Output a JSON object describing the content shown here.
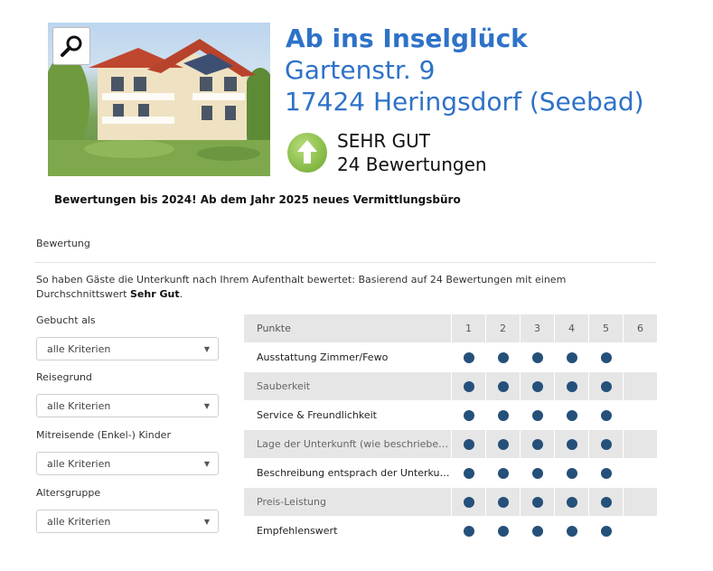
{
  "listing": {
    "title": "Ab ins Inselglück",
    "address_line1": "Gartenstr. 9",
    "address_line2": "17424 Heringsdorf (Seebad)"
  },
  "score": {
    "label": "SEHR GUT",
    "count_text": "24 Bewertungen",
    "icon": "arrow-up-icon",
    "icon_color": "#8cc04b"
  },
  "notice": "Bewertungen bis 2024! Ab dem Jahr 2025 neues Vermittlungsbüro",
  "section_label": "Bewertung",
  "description": {
    "text": "So haben Gäste die Unterkunft nach Ihrem Aufenthalt bewertet:  Basierend auf 24 Bewertungen mit einem Durchschnittswert",
    "bold": "Sehr Gut",
    "end": "."
  },
  "filters": [
    {
      "label": "Gebucht als",
      "value": "alle Kriterien"
    },
    {
      "label": "Reisegrund",
      "value": "alle Kriterien"
    },
    {
      "label": "Mitreisende (Enkel-) Kinder",
      "value": "alle Kriterien"
    },
    {
      "label": "Altersgruppe",
      "value": "alle Kriterien"
    }
  ],
  "ratings": {
    "header": "Punkte",
    "scale": [
      "1",
      "2",
      "3",
      "4",
      "5",
      "6"
    ],
    "rows": [
      {
        "label": "Ausstattung Zimmer/Fewo",
        "points": 5
      },
      {
        "label": "Sauberkeit",
        "points": 5
      },
      {
        "label": "Service & Freundlichkeit",
        "points": 5
      },
      {
        "label": "Lage der Unterkunft (wie beschriebe…",
        "points": 5
      },
      {
        "label": "Beschreibung entsprach der Unterku…",
        "points": 5
      },
      {
        "label": "Preis-Leistung",
        "points": 5
      },
      {
        "label": "Empfehlenswert",
        "points": 5
      }
    ],
    "dot_color": "#24507a"
  },
  "colors": {
    "accent": "#2e72c8"
  }
}
